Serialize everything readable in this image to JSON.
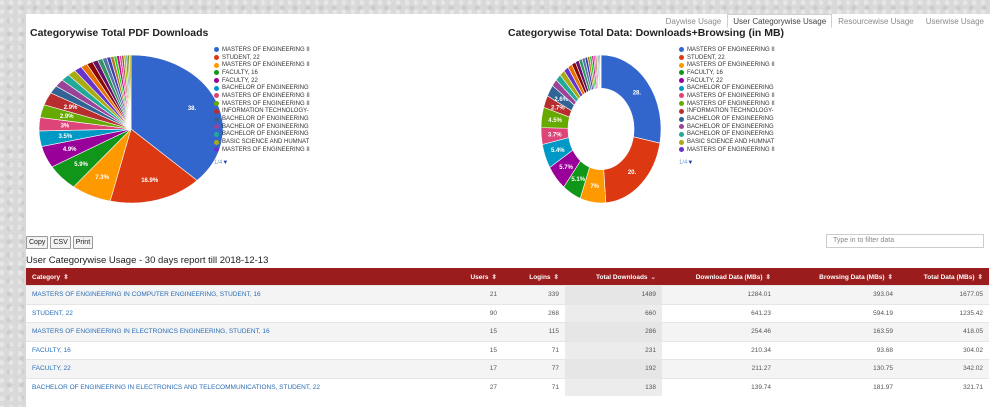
{
  "tabs": [
    {
      "label": "Daywise Usage",
      "active": false
    },
    {
      "label": "User Categorywise Usage",
      "active": true
    },
    {
      "label": "Resourcewise Usage",
      "active": false
    },
    {
      "label": "Userwise Usage",
      "active": false
    }
  ],
  "legend_labels": [
    "MASTERS OF ENGINEERING II",
    "STUDENT, 22",
    "MASTERS OF ENGINEERING II",
    "FACULTY, 16",
    "FACULTY, 22",
    "BACHELOR OF ENGINEERING",
    "MASTERS OF ENGINEERING II",
    "MASTERS OF ENGINEERING II",
    "INFORMATION TECHNOLOGY-",
    "BACHELOR OF ENGINEERING",
    "BACHELOR OF ENGINEERING",
    "BACHELOR OF ENGINEERING",
    "BASIC SCIENCE AND HUMNAT",
    "MASTERS OF ENGINEERING II"
  ],
  "legend_colors": [
    "#3366cc",
    "#dc3912",
    "#ff9900",
    "#109618",
    "#990099",
    "#0099c6",
    "#dd4477",
    "#66aa00",
    "#b82e2e",
    "#316395",
    "#994499",
    "#22aa99",
    "#aaaa11",
    "#6633cc"
  ],
  "legend_nav": "1/4",
  "chart_data": [
    {
      "type": "pie",
      "title": "Categorywise Total PDF Downloads",
      "slices": [
        {
          "label": "MASTERS OF ENGINEERING II",
          "percent": 38.4,
          "color": "#3366cc",
          "shown": "38."
        },
        {
          "label": "STUDENT, 22",
          "percent": 16.9,
          "color": "#dc3912",
          "shown": "16.9%"
        },
        {
          "label": "MASTERS OF ENGINEERING II",
          "percent": 7.3,
          "color": "#ff9900",
          "shown": "7.3%"
        },
        {
          "label": "FACULTY, 16",
          "percent": 5.9,
          "color": "#109618",
          "shown": "5.9%"
        },
        {
          "label": "FACULTY, 22",
          "percent": 4.9,
          "color": "#990099",
          "shown": "4.9%"
        },
        {
          "label": "BACHELOR OF ENGINEERING",
          "percent": 3.5,
          "color": "#0099c6",
          "shown": "3.5%"
        },
        {
          "label": "MASTERS OF ENGINEERING II",
          "percent": 3.0,
          "color": "#dd4477",
          "shown": "3%"
        },
        {
          "label": "MASTERS OF ENGINEERING II",
          "percent": 2.9,
          "color": "#66aa00",
          "shown": "2.9%"
        },
        {
          "label": "INFORMATION TECHNOLOGY-",
          "percent": 2.9,
          "color": "#b82e2e",
          "shown": "2.9%"
        },
        {
          "label": "other",
          "percent": 1.8,
          "color": "#316395",
          "shown": ""
        },
        {
          "label": "other",
          "percent": 1.7,
          "color": "#994499",
          "shown": ""
        },
        {
          "label": "other",
          "percent": 1.6,
          "color": "#22aa99",
          "shown": ""
        },
        {
          "label": "other",
          "percent": 1.5,
          "color": "#aaaa11",
          "shown": ""
        },
        {
          "label": "other",
          "percent": 1.4,
          "color": "#6633cc",
          "shown": ""
        },
        {
          "label": "other",
          "percent": 1.2,
          "color": "#e67300",
          "shown": ""
        },
        {
          "label": "other",
          "percent": 1.1,
          "color": "#8b0707",
          "shown": ""
        },
        {
          "label": "other",
          "percent": 1.0,
          "color": "#651067",
          "shown": ""
        },
        {
          "label": "other",
          "percent": 0.9,
          "color": "#329262",
          "shown": ""
        },
        {
          "label": "other",
          "percent": 0.8,
          "color": "#5574a6",
          "shown": ""
        },
        {
          "label": "other",
          "percent": 0.7,
          "color": "#3b3eac",
          "shown": ""
        },
        {
          "label": "other",
          "percent": 0.6,
          "color": "#b77322",
          "shown": ""
        },
        {
          "label": "other",
          "percent": 0.5,
          "color": "#16d620",
          "shown": ""
        },
        {
          "label": "other",
          "percent": 0.5,
          "color": "#b91383",
          "shown": ""
        },
        {
          "label": "other",
          "percent": 0.4,
          "color": "#f4359e",
          "shown": ""
        },
        {
          "label": "other",
          "percent": 0.4,
          "color": "#9c5935",
          "shown": ""
        },
        {
          "label": "other",
          "percent": 0.4,
          "color": "#a9c413",
          "shown": ""
        },
        {
          "label": "other",
          "percent": 0.3,
          "color": "#2a778d",
          "shown": ""
        },
        {
          "label": "other",
          "percent": 0.3,
          "color": "#668d1c",
          "shown": ""
        },
        {
          "label": "other",
          "percent": 0.3,
          "color": "#bea413",
          "shown": ""
        }
      ]
    },
    {
      "type": "pie",
      "title": "Categorywise Total Data: Downloads+Browsing (in MB)",
      "donut": true,
      "slices": [
        {
          "label": "MASTERS OF ENGINEERING II",
          "percent": 28.4,
          "color": "#3366cc",
          "shown": "28."
        },
        {
          "label": "STUDENT, 22",
          "percent": 20.9,
          "color": "#dc3912",
          "shown": "20."
        },
        {
          "label": "MASTERS OF ENGINEERING II",
          "percent": 7.0,
          "color": "#ff9900",
          "shown": "7%"
        },
        {
          "label": "FACULTY, 16",
          "percent": 5.1,
          "color": "#109618",
          "shown": "5.1%"
        },
        {
          "label": "FACULTY, 22",
          "percent": 5.7,
          "color": "#990099",
          "shown": "5.7%"
        },
        {
          "label": "BACHELOR OF ENGINEERING",
          "percent": 5.4,
          "color": "#0099c6",
          "shown": "5.4%"
        },
        {
          "label": "MASTERS OF ENGINEERING II",
          "percent": 3.7,
          "color": "#dd4477",
          "shown": "3.7%"
        },
        {
          "label": "MASTERS OF ENGINEERING II",
          "percent": 4.5,
          "color": "#66aa00",
          "shown": "4.5%"
        },
        {
          "label": "INFORMATION TECHNOLOGY-",
          "percent": 2.7,
          "color": "#b82e2e",
          "shown": "2.7%"
        },
        {
          "label": "BACHELOR OF ENGINEERING",
          "percent": 2.6,
          "color": "#316395",
          "shown": "2.6%"
        },
        {
          "label": "other",
          "percent": 1.6,
          "color": "#994499",
          "shown": ""
        },
        {
          "label": "other",
          "percent": 1.5,
          "color": "#22aa99",
          "shown": ""
        },
        {
          "label": "other",
          "percent": 1.4,
          "color": "#aaaa11",
          "shown": ""
        },
        {
          "label": "other",
          "percent": 1.3,
          "color": "#6633cc",
          "shown": ""
        },
        {
          "label": "other",
          "percent": 1.2,
          "color": "#e67300",
          "shown": ""
        },
        {
          "label": "other",
          "percent": 1.1,
          "color": "#8b0707",
          "shown": ""
        },
        {
          "label": "other",
          "percent": 1.0,
          "color": "#651067",
          "shown": ""
        },
        {
          "label": "other",
          "percent": 0.9,
          "color": "#329262",
          "shown": ""
        },
        {
          "label": "other",
          "percent": 0.8,
          "color": "#5574a6",
          "shown": ""
        },
        {
          "label": "other",
          "percent": 0.7,
          "color": "#3b3eac",
          "shown": ""
        },
        {
          "label": "other",
          "percent": 0.6,
          "color": "#b77322",
          "shown": ""
        },
        {
          "label": "other",
          "percent": 0.6,
          "color": "#16d620",
          "shown": ""
        },
        {
          "label": "other",
          "percent": 0.5,
          "color": "#b91383",
          "shown": ""
        },
        {
          "label": "other",
          "percent": 0.4,
          "color": "#f4359e",
          "shown": ""
        },
        {
          "label": "other",
          "percent": 0.4,
          "color": "#9c5935",
          "shown": ""
        },
        {
          "label": "other",
          "percent": 0.3,
          "color": "#a9c413",
          "shown": ""
        },
        {
          "label": "other",
          "percent": 0.3,
          "color": "#2a778d",
          "shown": ""
        },
        {
          "label": "other",
          "percent": 0.3,
          "color": "#668d1c",
          "shown": ""
        },
        {
          "label": "other",
          "percent": 0.2,
          "color": "#bea413",
          "shown": ""
        },
        {
          "label": "other",
          "percent": 0.1,
          "color": "#0c5922",
          "shown": ""
        }
      ]
    }
  ],
  "export_buttons": [
    "Copy",
    "CSV",
    "Print"
  ],
  "filter_placeholder": "Type in to filter data",
  "report_title": "User Categorywise Usage - 30 days report till 2018-12-13",
  "table": {
    "headers": [
      "Category",
      "Users",
      "Logins",
      "Total Downloads",
      "Download Data (MBs)",
      "Browsing Data (MBs)",
      "Total Data (MBs)"
    ],
    "rows": [
      [
        "MASTERS OF ENGINEERING IN COMPUTER ENGINEERING, STUDENT, 16",
        "21",
        "339",
        "1489",
        "1284.01",
        "393.04",
        "1677.05"
      ],
      [
        "STUDENT, 22",
        "90",
        "268",
        "660",
        "641.23",
        "594.19",
        "1235.42"
      ],
      [
        "MASTERS OF ENGINEERING IN ELECTRONICS ENGINEERING, STUDENT, 16",
        "15",
        "115",
        "286",
        "254.46",
        "163.59",
        "418.05"
      ],
      [
        "FACULTY, 16",
        "15",
        "71",
        "231",
        "210.34",
        "93.68",
        "304.02"
      ],
      [
        "FACULTY, 22",
        "17",
        "77",
        "192",
        "211.27",
        "130.75",
        "342.02"
      ],
      [
        "BACHELOR OF ENGINEERING IN ELECTRONICS AND TELECOMMUNICATIONS, STUDENT, 22",
        "27",
        "71",
        "138",
        "139.74",
        "181.97",
        "321.71"
      ]
    ]
  }
}
